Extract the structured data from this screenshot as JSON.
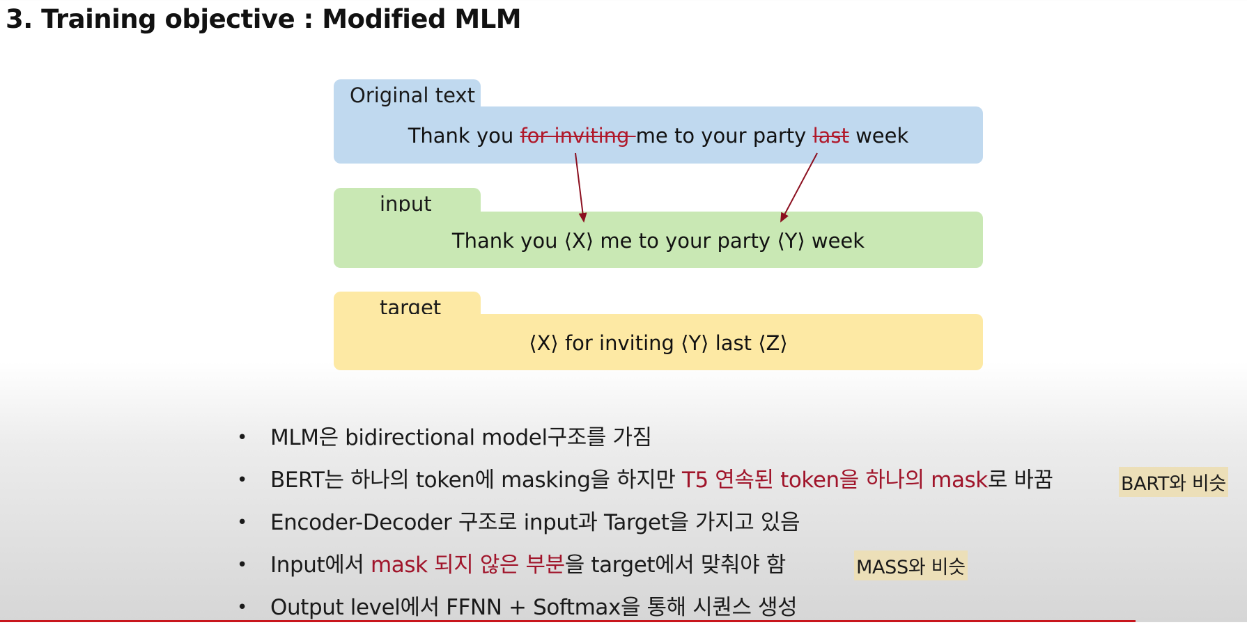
{
  "slide_title": "3. Training objective : Modified MLM",
  "diagram": {
    "original": {
      "label": "Original text",
      "seg1": "Thank you ",
      "seg2_struck": "for inviting ",
      "seg3": "me to your party ",
      "seg4_struck": "last",
      "seg5": " week"
    },
    "input": {
      "label": "input",
      "text": "Thank you ⟨X⟩ me to your party ⟨Y⟩ week"
    },
    "target": {
      "label": "target",
      "text": "⟨X⟩ for inviting ⟨Y⟩ last ⟨Z⟩"
    },
    "arrow_color": "#8b0f1f"
  },
  "bullets": {
    "symbol": "•",
    "b1": {
      "text": "MLM은 bidirectional model구조를 가짐"
    },
    "b2": {
      "pre": "BERT는 하나의 token에 masking을 하지만 ",
      "red": "T5 연속된 token을 하나의 mask",
      "post": "로 바꿈"
    },
    "b3": {
      "text": "Encoder-Decoder 구조로 input과 Target을 가지고 있음"
    },
    "b4": {
      "pre": "Input에서 ",
      "red": "mask 되지 않은 부분",
      "post": "을 target에서 맞춰야 함"
    },
    "b5": {
      "text": "Output level에서 FFNN + Softmax을 통해 시퀀스 생성"
    }
  },
  "notes": {
    "bart": "BART와 비슷",
    "mass": "MASS와 비슷"
  },
  "colors": {
    "accent_red": "#a0142a",
    "original_bg": "#c0d9ef",
    "input_bg": "#c9e8b4",
    "target_bg": "#fde9a4",
    "note_bg": "#ecdfb8",
    "bottom_rule": "#c8161d"
  }
}
